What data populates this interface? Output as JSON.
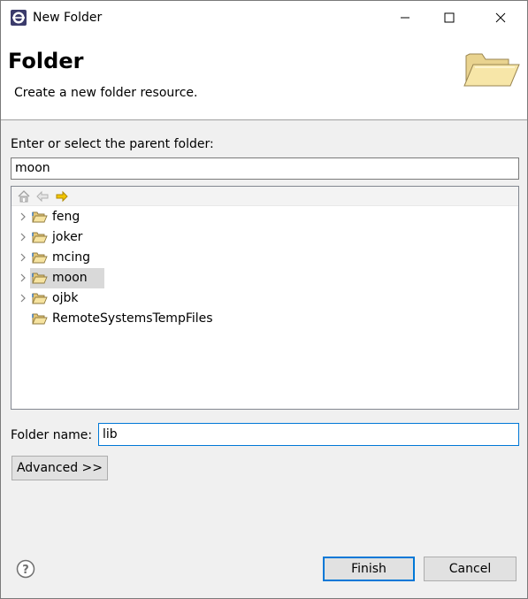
{
  "window": {
    "title": "New Folder"
  },
  "banner": {
    "title": "Folder",
    "description": "Create a new folder resource."
  },
  "parent": {
    "label": "Enter or select the parent folder:",
    "value": "moon"
  },
  "tree": {
    "items": [
      {
        "label": "feng",
        "expandable": true,
        "selected": false
      },
      {
        "label": "joker",
        "expandable": true,
        "selected": false
      },
      {
        "label": "mcing",
        "expandable": true,
        "selected": false
      },
      {
        "label": "moon",
        "expandable": true,
        "selected": true
      },
      {
        "label": "ojbk",
        "expandable": true,
        "selected": false
      },
      {
        "label": "RemoteSystemsTempFiles",
        "expandable": false,
        "selected": false
      }
    ]
  },
  "folder_name": {
    "label": "Folder name:",
    "value": "lib"
  },
  "buttons": {
    "advanced": "Advanced >>",
    "finish": "Finish",
    "cancel": "Cancel"
  },
  "icons": {
    "app": "eclipse-icon",
    "banner": "open-folder-icon",
    "home": "home-icon",
    "back": "back-arrow-icon",
    "forward": "forward-arrow-icon",
    "help": "help-icon"
  },
  "colors": {
    "accent": "#0078d7",
    "forward_arrow": "#e8b800",
    "selection": "#d9d9d9"
  }
}
